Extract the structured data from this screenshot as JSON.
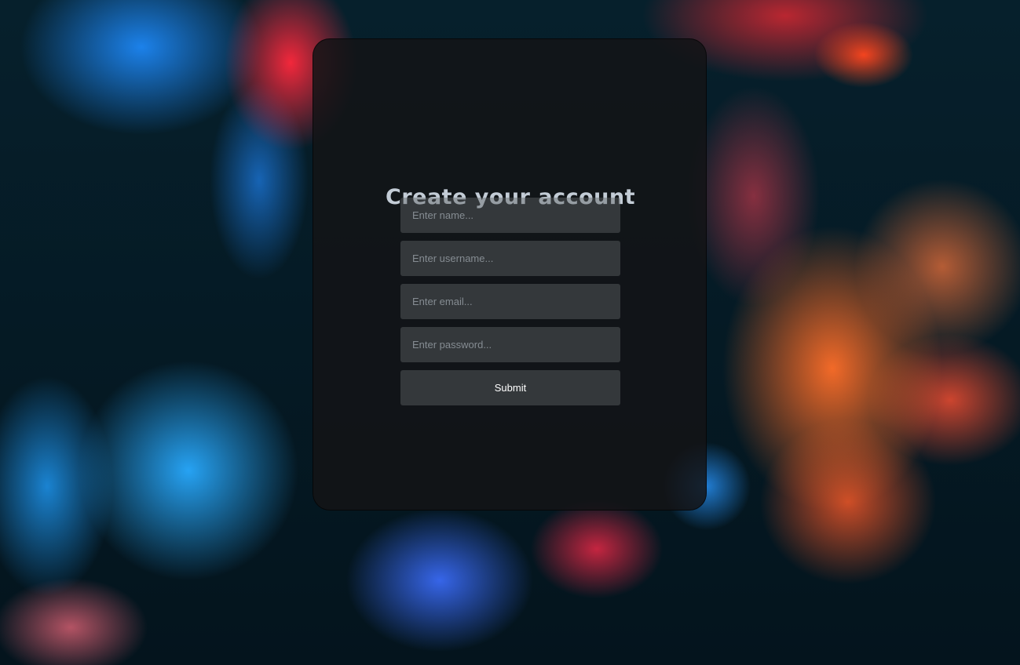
{
  "form": {
    "title": "Create your account",
    "fields": [
      {
        "placeholder": "Enter name...",
        "value": ""
      },
      {
        "placeholder": "Enter username...",
        "value": ""
      },
      {
        "placeholder": "Enter email...",
        "value": ""
      },
      {
        "placeholder": "Enter password...",
        "value": ""
      }
    ],
    "submit_label": "Submit"
  },
  "colors": {
    "card_background": "#141416",
    "title_text": "#c3ccd6",
    "field_background": "#5f6467",
    "placeholder_text": "#858c92",
    "button_text": "#ffffff"
  }
}
